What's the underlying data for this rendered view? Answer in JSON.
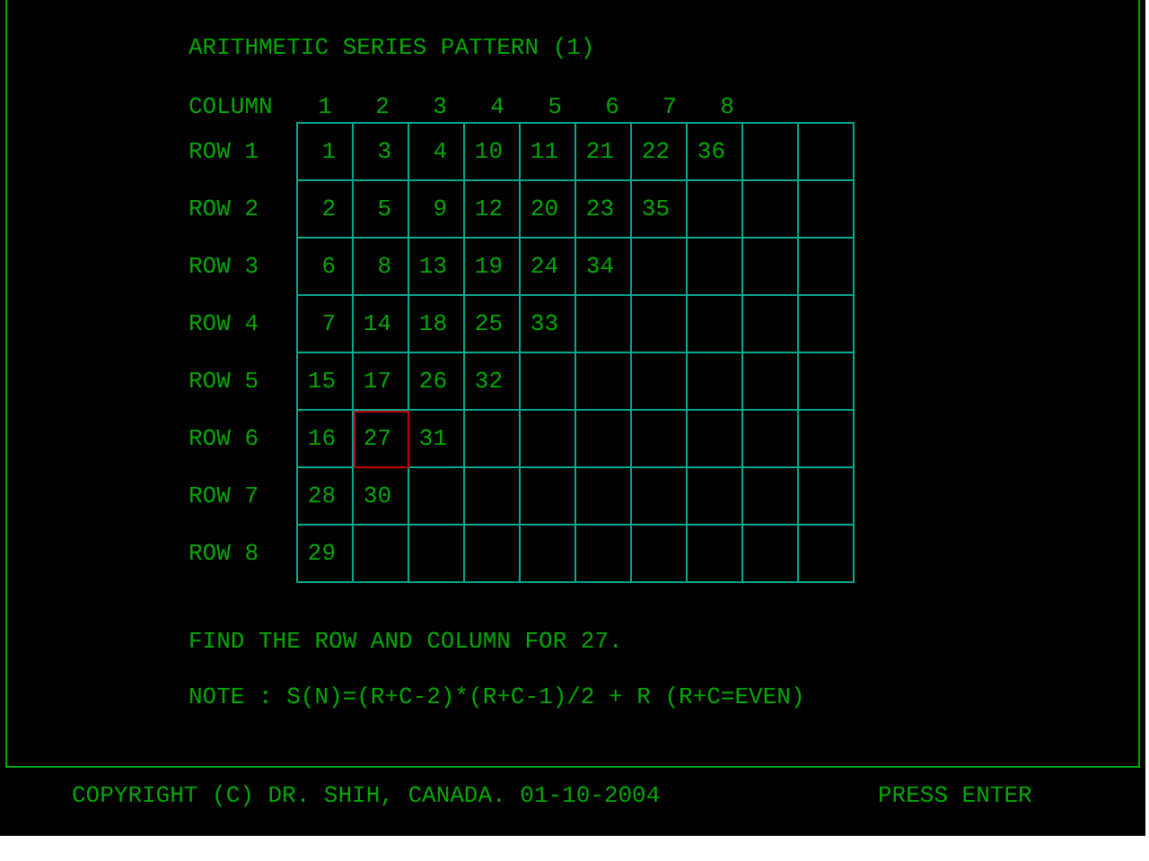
{
  "title": "ARITHMETIC SERIES PATTERN (1)",
  "column_header": {
    "label": "COLUMN",
    "numbers": [
      "1",
      "2",
      "3",
      "4",
      "5",
      "6",
      "7",
      "8"
    ]
  },
  "rows": [
    {
      "label": "ROW 1",
      "cells": [
        {
          "text": "1",
          "selected": false
        },
        {
          "text": "3",
          "selected": false
        },
        {
          "text": "4",
          "selected": false
        },
        {
          "text": "10",
          "selected": false
        },
        {
          "text": "11",
          "selected": false
        },
        {
          "text": "21",
          "selected": false
        },
        {
          "text": "22",
          "selected": false
        },
        {
          "text": "36",
          "selected": false
        }
      ]
    },
    {
      "label": "ROW 2",
      "cells": [
        {
          "text": "2",
          "selected": false
        },
        {
          "text": "5",
          "selected": false
        },
        {
          "text": "9",
          "selected": false
        },
        {
          "text": "12",
          "selected": false
        },
        {
          "text": "20",
          "selected": false
        },
        {
          "text": "23",
          "selected": false
        },
        {
          "text": "35",
          "selected": false
        }
      ]
    },
    {
      "label": "ROW 3",
      "cells": [
        {
          "text": "6",
          "selected": false
        },
        {
          "text": "8",
          "selected": false
        },
        {
          "text": "13",
          "selected": false
        },
        {
          "text": "19",
          "selected": false
        },
        {
          "text": "24",
          "selected": false
        },
        {
          "text": "34",
          "selected": false
        }
      ]
    },
    {
      "label": "ROW 4",
      "cells": [
        {
          "text": "7",
          "selected": false
        },
        {
          "text": "14",
          "selected": false
        },
        {
          "text": "18",
          "selected": false
        },
        {
          "text": "25",
          "selected": false
        },
        {
          "text": "33",
          "selected": false
        }
      ]
    },
    {
      "label": "ROW 5",
      "cells": [
        {
          "text": "15",
          "selected": false
        },
        {
          "text": "17",
          "selected": false
        },
        {
          "text": "26",
          "selected": false
        },
        {
          "text": "32",
          "selected": false
        }
      ]
    },
    {
      "label": "ROW 6",
      "cells": [
        {
          "text": "16",
          "selected": false
        },
        {
          "text": "27",
          "selected": true
        },
        {
          "text": "31",
          "selected": false
        }
      ]
    },
    {
      "label": "ROW 7",
      "cells": [
        {
          "text": "28",
          "selected": false
        },
        {
          "text": "30",
          "selected": false
        }
      ]
    },
    {
      "label": "ROW 8",
      "cells": [
        {
          "text": "29",
          "selected": false
        }
      ]
    }
  ],
  "question": "FIND THE ROW AND COLUMN FOR 27.",
  "note": "NOTE : S(N)=(R+C-2)*(R+C-1)/2 + R (R+C=EVEN)",
  "footer": {
    "copyright": "COPYRIGHT (C) DR. SHIH, CANADA. 01-10-2004",
    "prompt": "PRESS ENTER"
  }
}
